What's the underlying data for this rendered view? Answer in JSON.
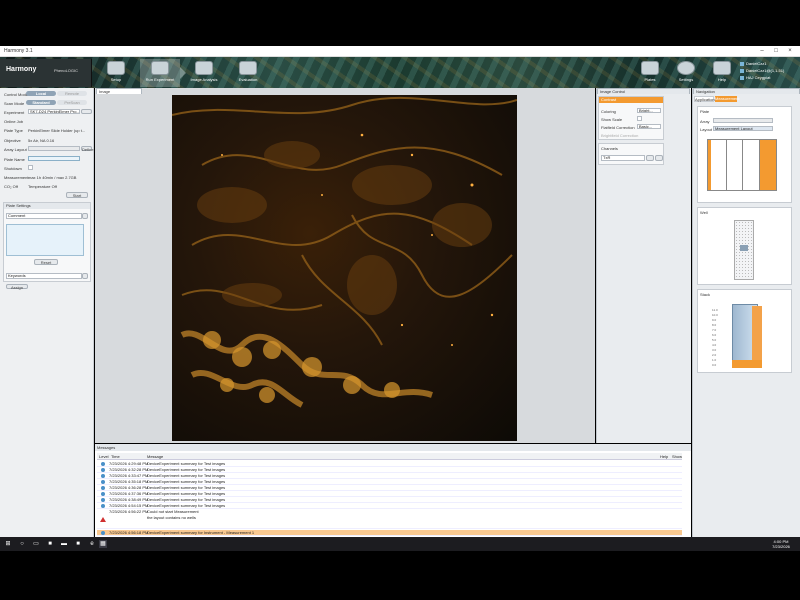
{
  "window": {
    "title": "Harmony 3.1"
  },
  "nav": {
    "items": [
      {
        "label": "Setup"
      },
      {
        "label": "Run Experiment"
      },
      {
        "label": "Image Analysis"
      },
      {
        "label": "Evaluation"
      }
    ],
    "right": [
      {
        "label": "Plates"
      },
      {
        "label": "Settings"
      },
      {
        "label": "Help"
      }
    ]
  },
  "logo": {
    "brand": "Harmony",
    "sub": "PhenoLOGIC"
  },
  "users": [
    "DanielCzz1",
    "DanielCzz1@(1,1.51)",
    "HAJ Ceygpiat"
  ],
  "left": {
    "control_mode": {
      "label": "Control Mode",
      "on": "Local",
      "off": "Remote"
    },
    "scan_mode": {
      "label": "Scan Mode",
      "on": "Standard",
      "off": "PreScan"
    },
    "experiment": {
      "label": "Experiment",
      "value": "SK7-D24 PerkinElmer Pro..."
    },
    "online_job": {
      "label": "Online Job"
    },
    "plate_type": {
      "label": "Plate Type",
      "value": "PerkinElmer Slide Holder (up t..."
    },
    "objective": {
      "label": "Objective",
      "value": "5x Air, NA 0.16"
    },
    "array_layout": {
      "label": "Array Layout",
      "value": "",
      "button": "Define"
    },
    "plate_name": {
      "label": "Plate Name",
      "value": ""
    },
    "shutdown": {
      "label": "Shutdown"
    },
    "measurement": {
      "label": "Measurement",
      "value": "max 1h 40min / max 2.7GB"
    },
    "co2": {
      "label": "CO₂ Off",
      "temp": "Temperature Off"
    },
    "start": "Start",
    "plate_settings": "Plate Settings",
    "comment": "Comment",
    "reset": "Reset",
    "keywords": "Keywords",
    "assign": "Assign"
  },
  "center": {
    "tab": "Image"
  },
  "imgcontrol": {
    "title": "Image Control",
    "section": "Contrast",
    "coloring": {
      "label": "Coloring",
      "value": "Bright..."
    },
    "show_scale": {
      "label": "Show Scale"
    },
    "flatfield": {
      "label": "Flatfield Correction",
      "value": "Basic..."
    },
    "brightfield": {
      "label": "Brightfield Correction"
    },
    "channels": {
      "title": "Channels",
      "value": "TxR"
    }
  },
  "navigation": {
    "title": "Navigation",
    "tabs": [
      "Application",
      "Measurement"
    ],
    "plate": {
      "title": "Plate",
      "array": "Array",
      "layout": "Layout",
      "layout_value": "Measurement Layout"
    },
    "well": {
      "title": "Well"
    },
    "stack": {
      "title": "Stack",
      "levels": [
        "11.0",
        "10.0",
        "9.0",
        "8.0",
        "7.0",
        "6.0",
        "5.0",
        "4.0",
        "3.0",
        "2.0",
        "1.0",
        "0.0"
      ]
    }
  },
  "messages": {
    "title": "Messages",
    "columns": {
      "level": "Level",
      "time": "Time",
      "message": "Message",
      "help": "Help",
      "show": "Show"
    },
    "rows": [
      {
        "time": "7/23/2026 4:29:48 PM",
        "msg": "DeviceExperiment summary for Test images",
        "type": "info"
      },
      {
        "time": "7/23/2026 4:32:28 PM",
        "msg": "DeviceExperiment summary for Test images",
        "type": "info"
      },
      {
        "time": "7/23/2026 4:33:47 PM",
        "msg": "DeviceExperiment summary for Test images",
        "type": "info"
      },
      {
        "time": "7/23/2026 4:35:18 PM",
        "msg": "DeviceExperiment summary for Test images",
        "type": "info"
      },
      {
        "time": "7/23/2026 4:36:28 PM",
        "msg": "DeviceExperiment summary for Test images",
        "type": "info"
      },
      {
        "time": "7/23/2026 4:37:36 PM",
        "msg": "DeviceExperiment summary for Test images",
        "type": "info"
      },
      {
        "time": "7/23/2026 4:38:49 PM",
        "msg": "DeviceExperiment summary for Test images",
        "type": "info"
      },
      {
        "time": "7/23/2026 4:54:15 PM",
        "msg": "DeviceExperiment summary for Test images",
        "type": "info"
      },
      {
        "time": "7/23/2026 4:56:22 PM",
        "msg": "Could not start Measurement",
        "msg2": "the layout contains no wells",
        "type": "warn"
      },
      {
        "time": "7/23/2026 4:56:18 PM",
        "msg": "DeviceExperiment summary for Instrument - Measurement 1",
        "type": "info"
      }
    ]
  },
  "clock": {
    "time": "4:00 PM",
    "date": "7/23/2026"
  }
}
